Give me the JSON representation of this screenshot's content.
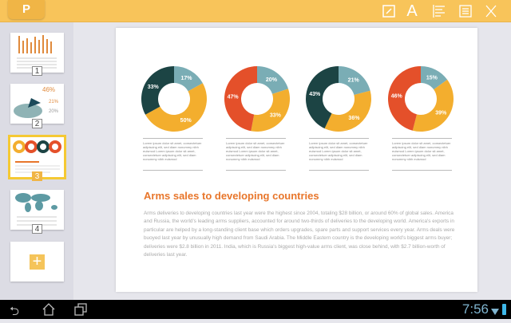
{
  "app": {
    "logo_letter": "P"
  },
  "toolbar": {
    "icons": [
      "edit-icon",
      "text-format-icon",
      "align-left-icon",
      "list-icon",
      "close-icon"
    ],
    "text_glyph": "A"
  },
  "sidebar": {
    "slides": [
      {
        "number": "1"
      },
      {
        "number": "2"
      },
      {
        "number": "3",
        "selected": true
      },
      {
        "number": "4"
      }
    ],
    "add_glyph": "+"
  },
  "colors": {
    "light_blue": "#7aadb5",
    "yellow": "#f3ae2e",
    "dark_teal": "#1c4444",
    "red": "#e4502a",
    "accent": "#e8762b",
    "toolbar": "#f8c45a"
  },
  "chart_data": [
    {
      "type": "pie",
      "donut": true,
      "values": [
        17,
        50,
        33
      ],
      "labels": [
        "17%",
        "50%",
        "33%"
      ],
      "colors": [
        "#7aadb5",
        "#f3ae2e",
        "#1c4444"
      ]
    },
    {
      "type": "pie",
      "donut": true,
      "values": [
        20,
        33,
        47
      ],
      "labels": [
        "20%",
        "33%",
        "47%"
      ],
      "colors": [
        "#7aadb5",
        "#f3ae2e",
        "#e4502a"
      ]
    },
    {
      "type": "pie",
      "donut": true,
      "values": [
        21,
        36,
        43
      ],
      "labels": [
        "21%",
        "36%",
        "43%"
      ],
      "colors": [
        "#7aadb5",
        "#f3ae2e",
        "#1c4444"
      ]
    },
    {
      "type": "pie",
      "donut": true,
      "values": [
        15,
        39,
        46
      ],
      "labels": [
        "15%",
        "39%",
        "46%"
      ],
      "colors": [
        "#7aadb5",
        "#f3ae2e",
        "#e4502a"
      ]
    }
  ],
  "captions": [
    "Lorem ipsum dolor sit amet, consectetuer adipiscing elit, sed diam nonummy nibh euismod Lorem ipsum dolor sit amet, consectetuer adipiscing elit, sed diam nonummy nibh euismod",
    "Lorem ipsum dolor sit amet, consectetuer adipiscing elit, sed diam nonummy nibh euismod Lorem ipsum dolor sit amet, consectetuer adipiscing elit, sed diam nonummy nibh euismod",
    "Lorem ipsum dolor sit amet, consectetuer adipiscing elit, sed diam nonummy nibh euismod Lorem ipsum dolor sit amet, consectetuer adipiscing elit, sed diam nonummy nibh euismod",
    "Lorem ipsum dolor sit amet, consectetuer adipiscing elit, sed diam nonummy nibh euismod Lorem ipsum dolor sit amet, consectetuer adipiscing elit, sed diam nonummy nibh euismod"
  ],
  "document": {
    "heading": "Arms sales to developing countries",
    "body": "Arms deliveries to developing countries last year were the highest since 2004, totaling $28 billion, or around 60% of global sales. America and Russia, the world's leading arms suppliers, accounted for around two-thirds of deliveries to the developing world. America's exports in particular are helped by a long-standing client base which orders upgrades, spare parts and support services every year. Arms deals were buoyed last year by unusually high demand from Saudi Arabia. The Middle Eastern country is the developing world's biggest arms buyer; deliveries were $2.8 billion in 2011. India, which is Russia's biggest high-value arms client, was close behind, with $2.7 billion-worth of deliveries last year."
  },
  "statusbar": {
    "time": "7:56"
  }
}
